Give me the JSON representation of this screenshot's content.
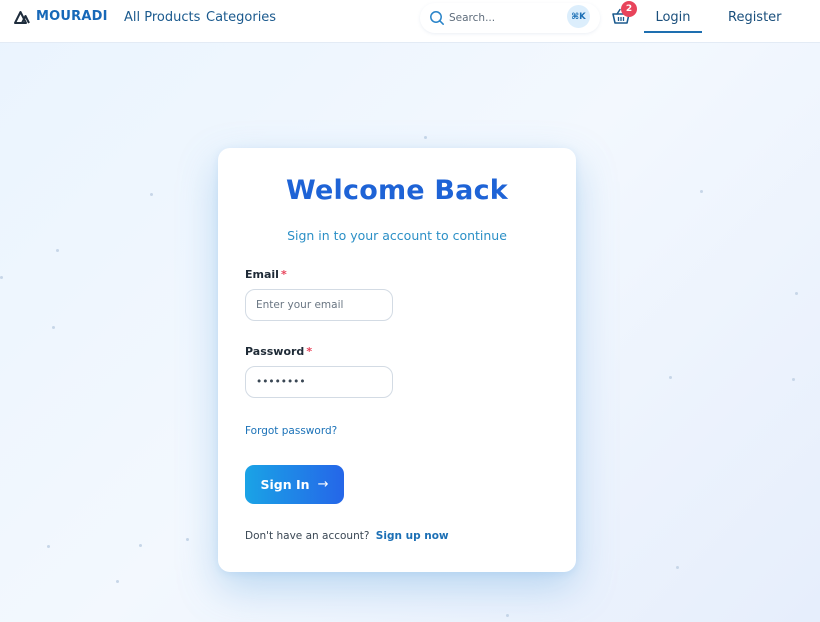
{
  "brand": {
    "name": "MOURADI"
  },
  "nav": {
    "links": [
      {
        "label": "All Products"
      },
      {
        "label": "Categories"
      }
    ],
    "search": {
      "placeholder": "Search...",
      "shortcut": "⌘K"
    },
    "cart": {
      "count": "2"
    },
    "login": "Login",
    "register": "Register"
  },
  "login_card": {
    "title": "Welcome Back",
    "subtitle": "Sign in to your account to continue",
    "email": {
      "label": "Email",
      "placeholder": "Enter your email",
      "required_mark": "*"
    },
    "password": {
      "label": "Password",
      "value": "••••••••",
      "required_mark": "*"
    },
    "forgot_link": "Forgot password?",
    "submit_label": "Sign In",
    "footer": {
      "prompt": "Don't have an account?",
      "link": "Sign up now"
    }
  },
  "colors": {
    "accent": "#1e63d6",
    "badge": "#e8445b",
    "button_start": "#1aa3e6",
    "button_end": "#2566e8"
  }
}
